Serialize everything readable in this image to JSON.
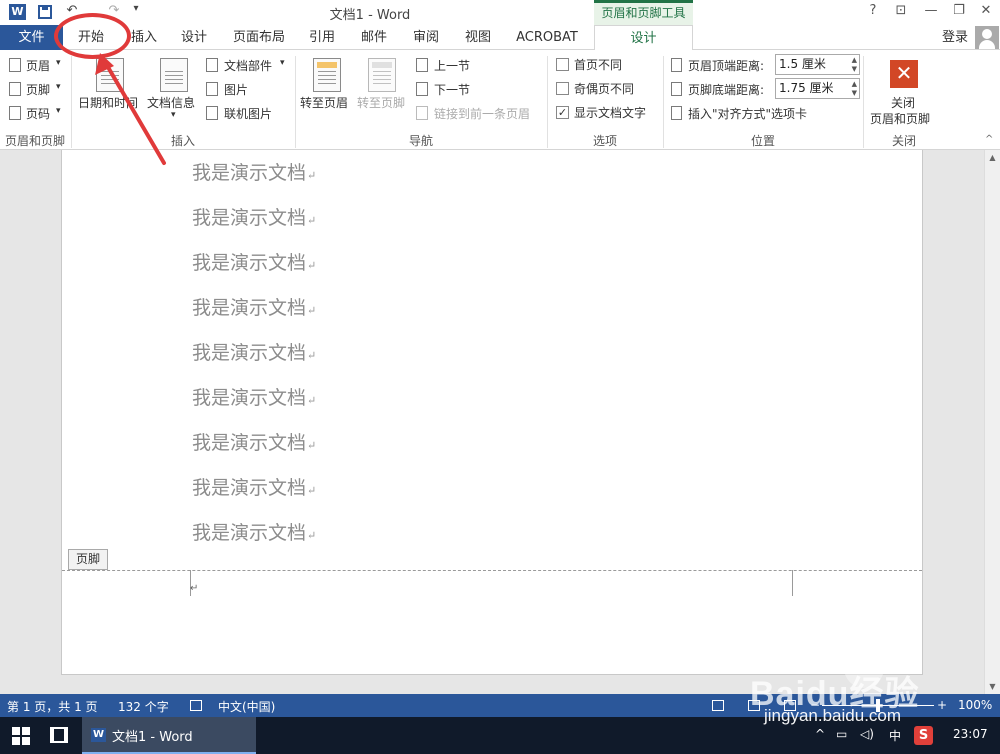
{
  "window": {
    "title": "文档1 - Word",
    "context_title": "页眉和页脚工具",
    "controls": [
      "?",
      "⊡",
      "—",
      "❐",
      "✕"
    ],
    "qat_extra": [
      "↶",
      "↷",
      "▾"
    ]
  },
  "tabs": {
    "file": "文件",
    "items": [
      "开始",
      "插入",
      "设计",
      "页面布局",
      "引用",
      "邮件",
      "审阅",
      "视图",
      "ACROBAT",
      "设计"
    ],
    "signin": "登录"
  },
  "ribbon": {
    "hf_group": {
      "header": "页眉",
      "footer": "页脚",
      "page_number": "页码",
      "label": "页眉和页脚"
    },
    "insert_group": {
      "datetime": "日期和时间",
      "docinfo": "文档信息",
      "docparts": "文档部件",
      "picture": "图片",
      "online_picture": "联机图片",
      "label": "插入"
    },
    "nav_group": {
      "goto_header": "转至页眉",
      "goto_footer": "转至页脚",
      "prev_section": "上一节",
      "next_section": "下一节",
      "link_prev": "链接到前一条页眉",
      "label": "导航"
    },
    "options_group": {
      "diff_first": "首页不同",
      "diff_odd_even": "奇偶页不同",
      "show_text": "显示文档文字",
      "label": "选项"
    },
    "position_group": {
      "header_dist_label": "页眉顶端距离:",
      "header_dist_value": "1.5 厘米",
      "footer_dist_label": "页脚底端距离:",
      "footer_dist_value": "1.75 厘米",
      "insert_align_tab": "插入\"对齐方式\"选项卡",
      "label": "位置"
    },
    "close_group": {
      "close_line1": "关闭",
      "close_line2": "页眉和页脚",
      "label": "关闭"
    },
    "dropdown_arrow": "▾"
  },
  "document": {
    "lines": [
      "我是演示文档",
      "我是演示文档",
      "我是演示文档",
      "我是演示文档",
      "我是演示文档",
      "我是演示文档",
      "我是演示文档",
      "我是演示文档",
      "我是演示文档"
    ],
    "para_mark": "↵",
    "footer_tag": "页脚"
  },
  "statusbar": {
    "page": "第 1 页，共 1 页",
    "words": "132 个字",
    "language": "中文(中国)",
    "zoom_minus": "−",
    "zoom_plus": "+",
    "zoom": "100%",
    "zoom_level": 1.0
  },
  "taskbar": {
    "app_label": "文档1 - Word",
    "ime": "中",
    "time": "23:07",
    "tray_icons": [
      "^",
      "▭",
      "◁)"
    ],
    "sogou": "S"
  },
  "watermark": {
    "brand": "Baidu经验",
    "url": "jingyan.baidu.com"
  },
  "colors": {
    "word_blue": "#2b579a",
    "context_green": "#217346",
    "annotation_red": "#e03a3a",
    "taskbar": "#101a2a"
  },
  "icons": [
    "word-logo-icon",
    "save-icon",
    "undo-icon",
    "redo-icon",
    "close-icon",
    "user-icon",
    "windows-icon",
    "task-view-icon"
  ]
}
